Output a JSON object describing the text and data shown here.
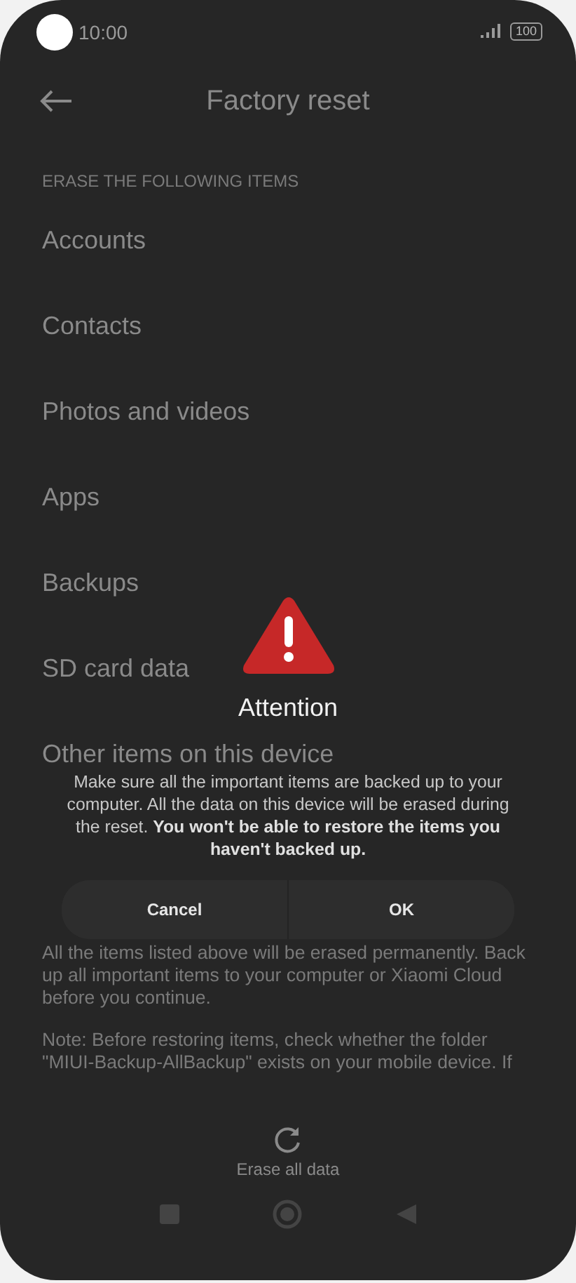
{
  "status_bar": {
    "time": "10:00",
    "battery": "100"
  },
  "header": {
    "title": "Factory reset"
  },
  "section_header": "ERASE THE FOLLOWING ITEMS",
  "items": [
    "Accounts",
    "Contacts",
    "Photos and videos",
    "Apps",
    "Backups",
    "SD card data",
    "Other items on this device"
  ],
  "notes": [
    "All the items listed above will be erased permanently. Back up all important items to your computer or Xiaomi Cloud before you continue.",
    "Note: Before restoring items, check whether the folder \"MIUI-Backup-AllBackup\" exists on your mobile device. If"
  ],
  "action": {
    "label": "Erase all data"
  },
  "dialog": {
    "title": "Attention",
    "message": "Make sure all the important items are backed up to your computer. All the data on this device will be erased during the reset. **You won't be able to restore the items you haven't backed up.**",
    "buttons": [
      "Cancel",
      "OK"
    ]
  }
}
